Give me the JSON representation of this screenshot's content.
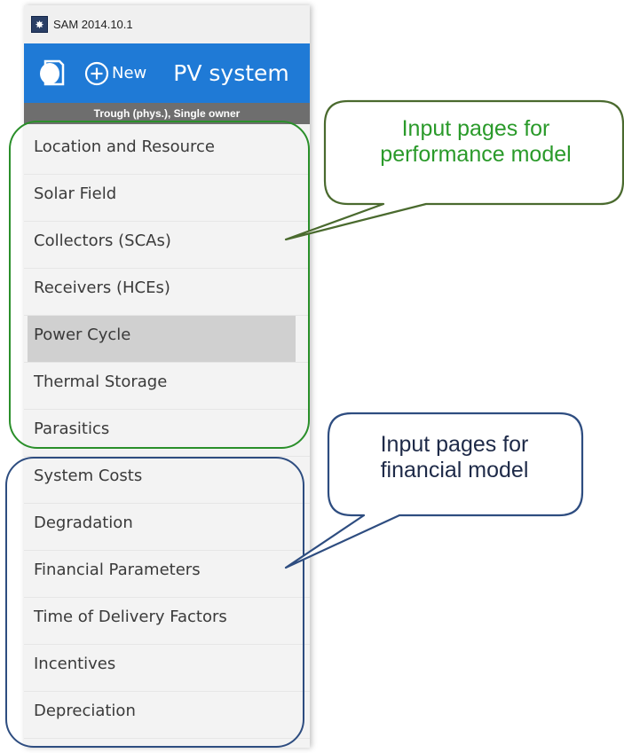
{
  "window": {
    "title": "SAM 2014.10.1",
    "icon": "sam-logo-icon"
  },
  "toolbar": {
    "open_icon": "open-file-icon",
    "new_icon": "plus-circle-icon",
    "new_label": "New",
    "case_name": "PV system"
  },
  "configuration": {
    "label": "Trough (phys.), Single owner"
  },
  "sidebar": {
    "items": [
      {
        "label": "Location and Resource"
      },
      {
        "label": "Solar Field"
      },
      {
        "label": "Collectors (SCAs)"
      },
      {
        "label": "Receivers (HCEs)"
      },
      {
        "label": "Power Cycle"
      },
      {
        "label": "Thermal Storage"
      },
      {
        "label": "Parasitics"
      },
      {
        "label": "System Costs"
      },
      {
        "label": "Degradation"
      },
      {
        "label": "Financial Parameters"
      },
      {
        "label": "Time of Delivery Factors"
      },
      {
        "label": "Incentives"
      },
      {
        "label": "Depreciation"
      }
    ],
    "selected": "Power Cycle"
  },
  "callouts": {
    "performance": {
      "line1": "Input pages for",
      "line2": "performance model",
      "color": "#2a9a2a"
    },
    "financial": {
      "line1": "Input pages for",
      "line2": "financial model",
      "color": "#2e4d80"
    }
  },
  "colors": {
    "toolbar": "#1f7ad6",
    "config_bar": "#6e6e6e",
    "selected_item": "#d0d0d0"
  }
}
